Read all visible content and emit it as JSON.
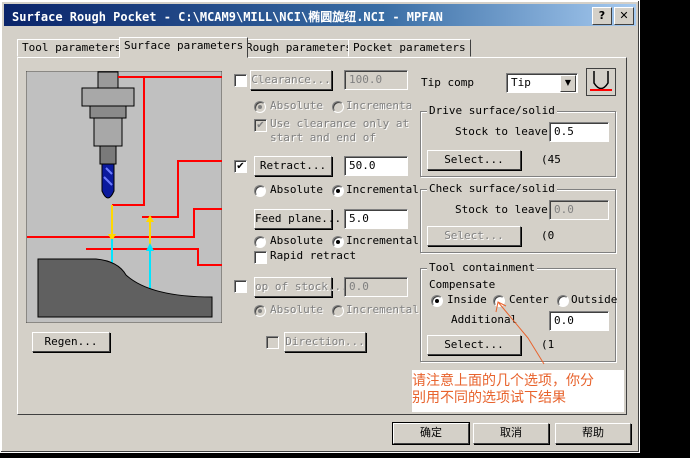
{
  "window": {
    "title": "Surface Rough Pocket - C:\\MCAM9\\MILL\\NCI\\椭圆旋纽.NCI - MPFAN",
    "help_glyph": "?",
    "close_glyph": "✕"
  },
  "tabs": [
    "Tool parameters",
    "Surface parameters",
    "Rough parameters",
    "Pocket parameters"
  ],
  "left": {
    "clearance": {
      "label": "Clearance...",
      "value": "100.0",
      "checked": ""
    },
    "clearance_mode": {
      "absolute": "Absolute",
      "incremental": "Incremental"
    },
    "use_clearance": {
      "checked": "✔",
      "line1": "Use clearance only at th",
      "line2": "start and end of"
    },
    "retract": {
      "label": "Retract...",
      "value": "50.0",
      "checked": "✔"
    },
    "retract_mode": {
      "absolute": "Absolute",
      "incremental": "Incremental"
    },
    "feed_plane": {
      "label": "Feed plane...",
      "value": "5.0"
    },
    "feed_mode": {
      "absolute": "Absolute",
      "incremental": "Incremental"
    },
    "rapid_retract": {
      "label": "Rapid retract",
      "checked": ""
    },
    "top_of_stock": {
      "label": "op of stock...",
      "value": "0.0",
      "checked": ""
    },
    "top_mode": {
      "absolute": "Absolute",
      "incremental": "Incremental"
    },
    "direction": {
      "label": "Direction...",
      "checked": ""
    },
    "regen": {
      "label": "Regen..."
    }
  },
  "right": {
    "tip_comp": {
      "label": "Tip comp",
      "value": "Tip"
    },
    "drive": {
      "title": "Drive surface/solid",
      "stock_label": "Stock to leave",
      "stock_value": "0.5",
      "select": "Select...",
      "count": "(45"
    },
    "check": {
      "title": "Check surface/solid",
      "stock_label": "Stock to leave",
      "stock_value": "0.0",
      "select": "Select...",
      "count": "(0"
    },
    "containment": {
      "title": "Tool containment",
      "compensate": "Compensate",
      "inside": "Inside",
      "center": "Center",
      "outside": "Outside",
      "additional": "Additional",
      "additional_value": "0.0",
      "select": "Select...",
      "count": "(1"
    }
  },
  "annotation": {
    "line1": "请注意上面的几个选项，你分",
    "line2": "别用不同的选项试下结果"
  },
  "footer": {
    "ok": "确定",
    "cancel": "取消",
    "help": "帮助"
  },
  "colors": {
    "title_start": "#0a246a",
    "title_end": "#a6caf0",
    "annotation": "#e8632d",
    "guide_red": "#ff0000",
    "tool_blue": "#0b1a9e"
  }
}
